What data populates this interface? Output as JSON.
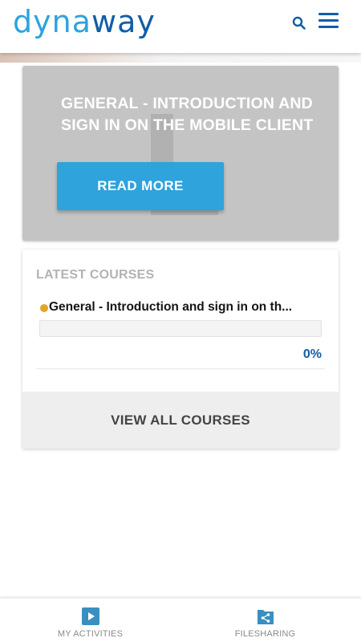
{
  "header": {
    "logo_part1": "dyna",
    "logo_part2": "way",
    "search_icon": "search-icon",
    "menu_icon": "hamburger-menu-icon"
  },
  "hero": {
    "title": "GENERAL - INTRODUCTION AND SIGN IN ON THE MOBILE CLIENT",
    "button_label": "READ MORE"
  },
  "latest_courses": {
    "heading": "LATEST COURSES",
    "items": [
      {
        "title": "General - Introduction and sign in on th...",
        "progress": 0,
        "progress_label": "0%",
        "status_color": "#e0a52a"
      }
    ],
    "view_all_label": "VIEW ALL COURSES"
  },
  "bottom_nav": {
    "items": [
      {
        "label": "MY ACTIVITIES",
        "icon": "play-icon"
      },
      {
        "label": "FILESHARING",
        "icon": "share-folder-icon"
      }
    ]
  },
  "colors": {
    "brand_light": "#2fa3dd",
    "brand_dark": "#0f5ea8",
    "accent_button": "#2ea3dc",
    "hero_background": "#c4c4c4",
    "nav_icon": "#3a8fc1"
  }
}
